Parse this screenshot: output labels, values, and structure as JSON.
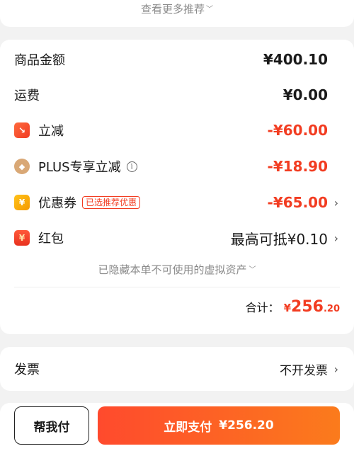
{
  "see_more": {
    "label": "查看更多推荐"
  },
  "summary": {
    "goods_amount": {
      "label": "商品金额",
      "value": "¥400.10"
    },
    "shipping": {
      "label": "运费",
      "value": "¥0.00"
    },
    "instant_discount": {
      "label": "立减",
      "value": "-¥60.00",
      "icon": "discount-arrow-icon"
    },
    "plus_discount": {
      "label": "PLUS专享立减",
      "value": "-¥18.90",
      "icon": "plus-badge-icon",
      "info_glyph": "i"
    },
    "coupon": {
      "label": "优惠券",
      "tag": "已选推荐优惠",
      "value": "-¥65.00",
      "icon": "coupon-yen-icon"
    },
    "red_packet": {
      "label": "红包",
      "value": "最高可抵¥0.10",
      "icon": "red-packet-icon"
    },
    "hidden_assets_note": "已隐藏本单不可使用的虚拟资产",
    "total": {
      "label": "合计：",
      "currency": "¥",
      "integer": "256",
      "decimal": ".20"
    }
  },
  "invoice": {
    "label": "发票",
    "value": "不开发票"
  },
  "actions": {
    "help_pay": "帮我付",
    "pay_label": "立即支付",
    "pay_amount": "¥256.20"
  },
  "colors": {
    "accent_red": "#f23c21",
    "button_gradient_start": "#ff4a2d",
    "button_gradient_end": "#fb7b1c"
  }
}
